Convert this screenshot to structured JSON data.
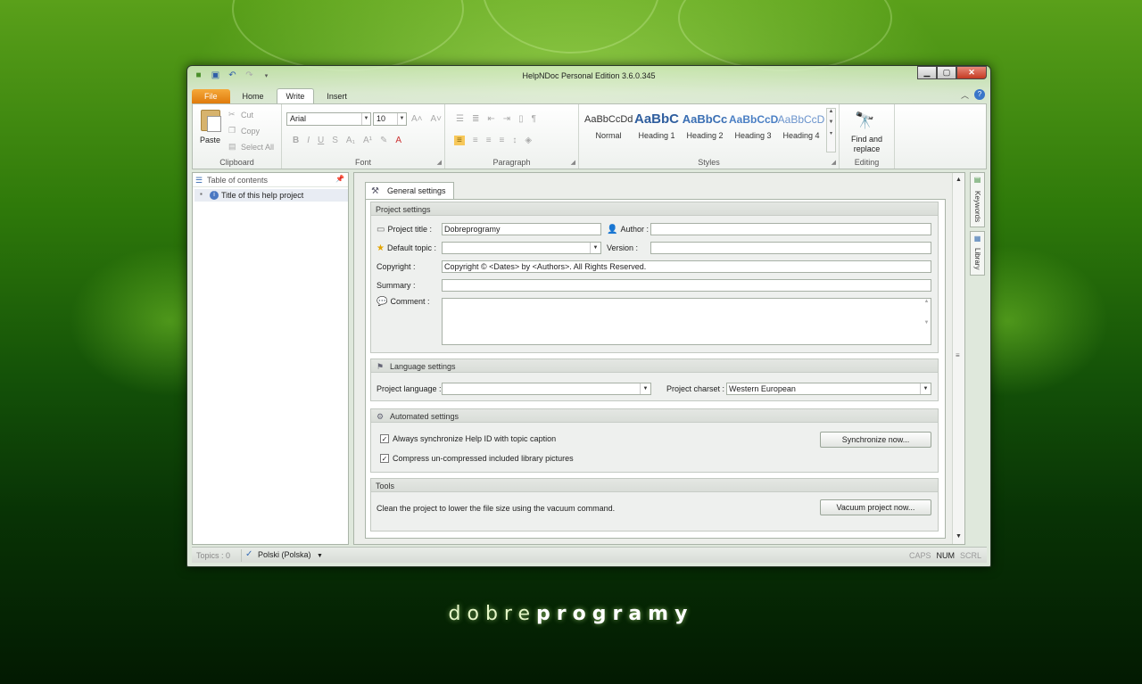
{
  "window": {
    "title": "HelpNDoc Personal Edition 3.6.0.345"
  },
  "window_controls": {
    "minimize": "▁",
    "maximize": "▢",
    "close": "✕"
  },
  "ribbon_tabs": [
    {
      "label": "File"
    },
    {
      "label": "Home"
    },
    {
      "label": "Write"
    },
    {
      "label": "Insert"
    }
  ],
  "clipboard": {
    "paste": "Paste",
    "cut": "Cut",
    "copy": "Copy",
    "select_all": "Select All",
    "group_label": "Clipboard"
  },
  "font": {
    "family": "Arial",
    "size": "10",
    "group_label": "Font"
  },
  "paragraph": {
    "group_label": "Paragraph"
  },
  "styles": {
    "items": [
      {
        "sample": "AaBbCcDd",
        "name": "Normal",
        "color": "#333333"
      },
      {
        "sample": "AaBbC",
        "name": "Heading 1",
        "color": "#2f5e9e"
      },
      {
        "sample": "AaBbCc",
        "name": "Heading 2",
        "color": "#3a6fb4"
      },
      {
        "sample": "AaBbCcD",
        "name": "Heading 3",
        "color": "#4a7fc4"
      },
      {
        "sample": "AaBbCcD",
        "name": "Heading 4",
        "color": "#6a93cc"
      }
    ],
    "group_label": "Styles"
  },
  "editing": {
    "find_replace": "Find and replace",
    "group_label": "Editing"
  },
  "left_pane": {
    "title": "Table of contents",
    "items": [
      {
        "label": "Title of this help project"
      }
    ]
  },
  "main": {
    "tab_label": "General settings",
    "project_settings": {
      "header": "Project settings",
      "title_label": "Project title :",
      "title_value": "Dobreprogramy",
      "author_label": "Author :",
      "author_value": "",
      "default_topic_label": "Default topic :",
      "default_topic_value": "",
      "version_label": "Version :",
      "version_value": "",
      "copyright_label": "Copyright :",
      "copyright_value": "Copyright © <Dates> by <Authors>. All Rights Reserved.",
      "summary_label": "Summary :",
      "summary_value": "",
      "comment_label": "Comment :",
      "comment_value": ""
    },
    "language_settings": {
      "header": "Language settings",
      "language_label": "Project language :",
      "language_value": "",
      "charset_label": "Project charset :",
      "charset_value": "Western European"
    },
    "automated_settings": {
      "header": "Automated settings",
      "sync_label": "Always synchronize Help ID with topic caption",
      "sync_checked": true,
      "compress_label": "Compress un-compressed included library pictures",
      "compress_checked": true,
      "sync_button": "Synchronize now..."
    },
    "tools": {
      "header": "Tools",
      "vacuum_text": "Clean the project to lower the file size using the vacuum command.",
      "vacuum_button": "Vacuum project now..."
    }
  },
  "side_tabs": [
    {
      "label": "Keywords"
    },
    {
      "label": "Library"
    }
  ],
  "status_bar": {
    "topics": "Topics : 0",
    "language": "Polski (Polska)",
    "caps": "CAPS",
    "num": "NUM",
    "scrl": "SCRL"
  },
  "brand": {
    "light": "dobre",
    "bold": "programy"
  },
  "colors": {
    "file_tab": "#e07b0c",
    "accent": "#3a76c9",
    "background": "#145208"
  }
}
